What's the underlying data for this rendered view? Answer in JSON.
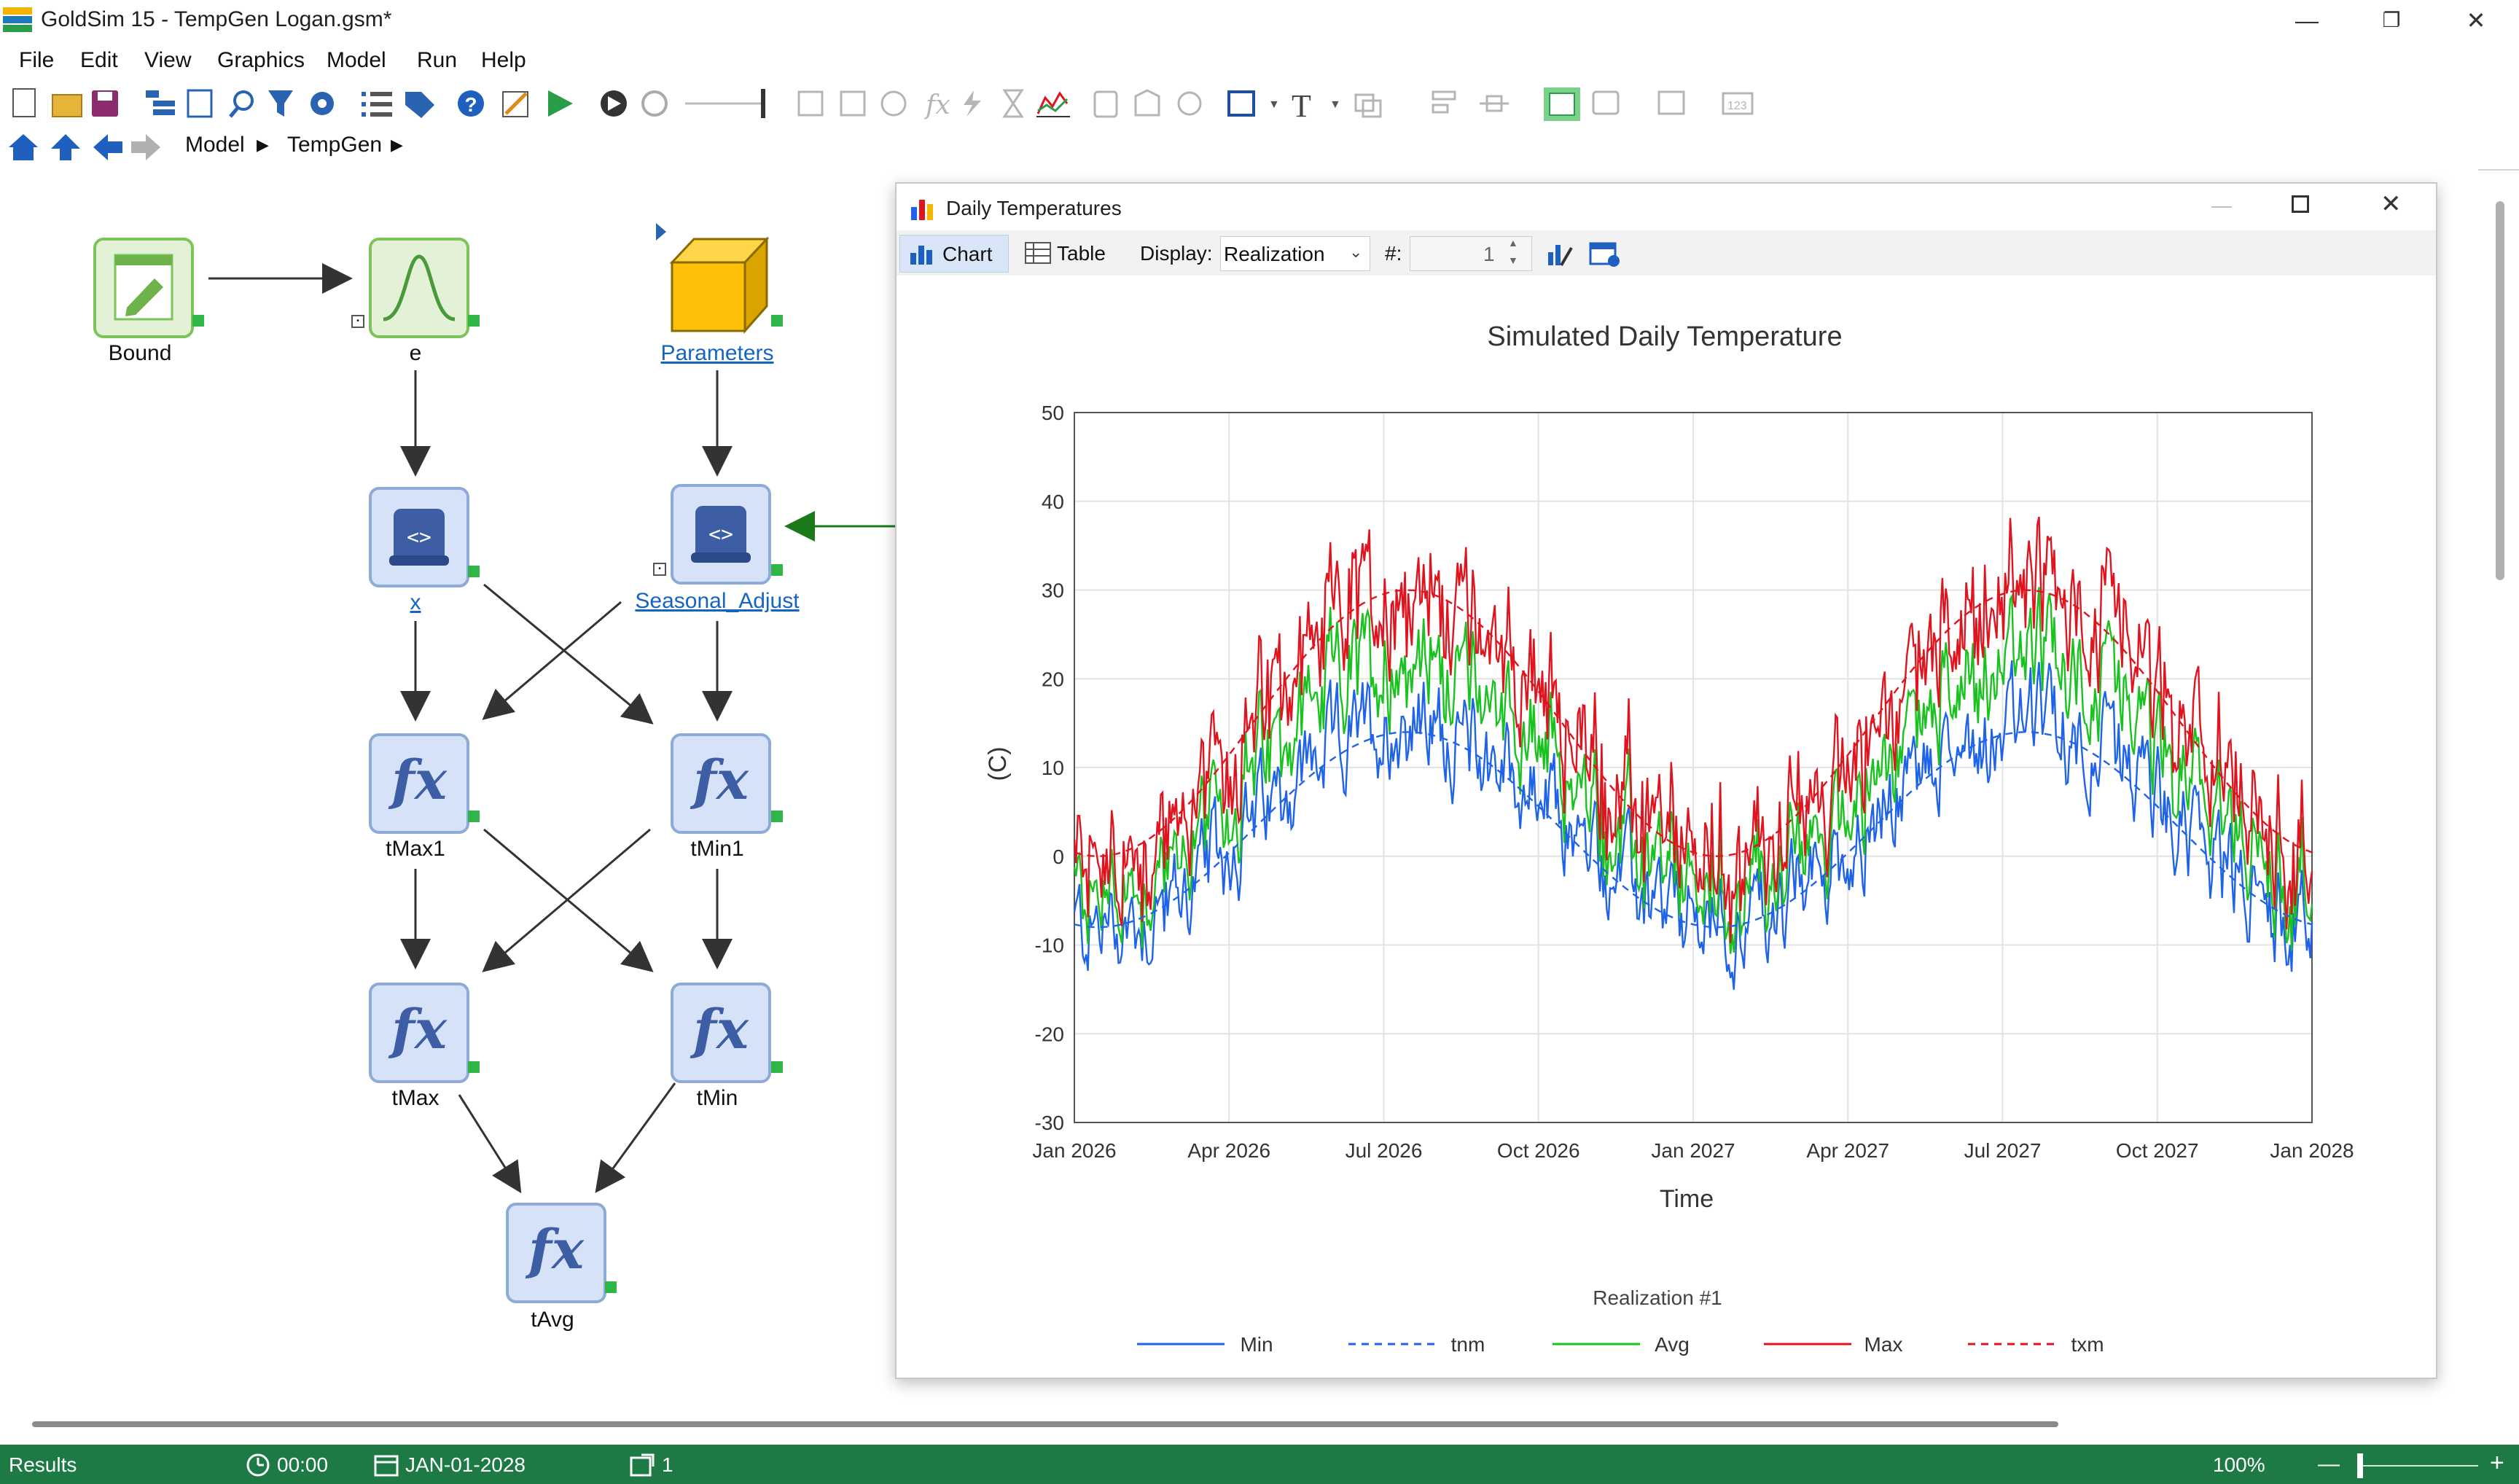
{
  "window": {
    "title": "GoldSim 15  - TempGen Logan.gsm*"
  },
  "menu": [
    "File",
    "Edit",
    "View",
    "Graphics",
    "Model",
    "Run",
    "Help"
  ],
  "breadcrumb": [
    "Model",
    "TempGen"
  ],
  "nodes": {
    "bound": "Bound",
    "e": "e",
    "parameters": "Parameters",
    "x": "x",
    "seasonal": "Seasonal_Adjust",
    "tmax1": "tMax1",
    "tmin1": "tMin1",
    "tmax": "tMax",
    "tmin": "tMin",
    "tavg": "tAvg"
  },
  "chart_window": {
    "title": "Daily Temperatures",
    "chart_tab": "Chart",
    "table_tab": "Table",
    "display_label": "Display:",
    "display_value": "Realization",
    "number_label": "#:",
    "number_value": "1"
  },
  "chart_data": {
    "type": "line",
    "title": "Simulated Daily Temperature",
    "xlabel": "Time",
    "ylabel": "(C)",
    "ylim": [
      -30,
      50
    ],
    "yticks": [
      "50",
      "40",
      "30",
      "20",
      "10",
      "0",
      "-10",
      "-20",
      "-30"
    ],
    "xticks": [
      "Jan 2026",
      "Apr 2026",
      "Jul 2026",
      "Oct 2026",
      "Jan 2027",
      "Apr 2027",
      "Jul 2027",
      "Oct 2027",
      "Jan 2028"
    ],
    "xrange": [
      "2026-01-01",
      "2028-01-01"
    ],
    "grid": true,
    "legend_title": "Realization #1",
    "legend_position": "bottom",
    "series": [
      {
        "name": "Min",
        "color": "#1f63e8",
        "style": "solid",
        "min": -21,
        "max": 15,
        "mean_low": -8,
        "mean_high": 15,
        "note_peak_months": [
          "Jul 2026",
          "Jul 2027"
        ]
      },
      {
        "name": "tnm",
        "color": "#1f63e8",
        "style": "dashed",
        "points": [
          [
            "Jan 2026",
            -8
          ],
          [
            "Jul 2026",
            14
          ],
          [
            "Jan 2027",
            -9
          ],
          [
            "Jul 2027",
            14
          ],
          [
            "Jan 2028",
            -8
          ]
        ]
      },
      {
        "name": "Avg",
        "color": "#19c21f",
        "style": "solid",
        "min": -15,
        "max": 28
      },
      {
        "name": "Max",
        "color": "#e0141e",
        "style": "solid",
        "min": -12,
        "max": 40
      },
      {
        "name": "txm",
        "color": "#e0141e",
        "style": "dashed",
        "points": [
          [
            "Jan 2026",
            0
          ],
          [
            "Jul 2026",
            30
          ],
          [
            "Jan 2027",
            -1
          ],
          [
            "Jul 2027",
            30
          ],
          [
            "Jan 2028",
            0
          ]
        ]
      }
    ]
  },
  "status": {
    "mode": "Results",
    "time": "00:00",
    "date": "JAN-01-2028",
    "realization": "1",
    "zoom": "100%"
  }
}
